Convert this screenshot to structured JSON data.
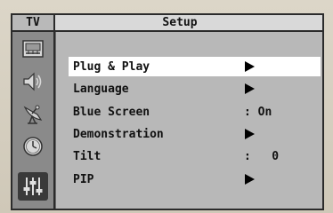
{
  "header": {
    "source": "TV",
    "title": "Setup"
  },
  "sidebar": {
    "icons": [
      {
        "name": "picture-icon"
      },
      {
        "name": "sound-icon"
      },
      {
        "name": "channel-antenna-icon"
      },
      {
        "name": "clock-icon"
      },
      {
        "name": "setup-sliders-icon"
      }
    ],
    "active_index": 4
  },
  "menu": {
    "items": [
      {
        "label": "Plug & Play",
        "type": "submenu",
        "value": ""
      },
      {
        "label": "Language",
        "type": "submenu",
        "value": ""
      },
      {
        "label": "Blue Screen",
        "type": "value",
        "value": ": On"
      },
      {
        "label": "Demonstration",
        "type": "submenu",
        "value": ""
      },
      {
        "label": "Tilt",
        "type": "value",
        "value": ":   0"
      },
      {
        "label": "PIP",
        "type": "submenu",
        "value": ""
      }
    ],
    "selected_index": 0
  },
  "colors": {
    "frame": "#2b2b2b",
    "sidebar": "#8a8a8a",
    "content": "#b8b8b8",
    "highlight": "#ffffff"
  }
}
